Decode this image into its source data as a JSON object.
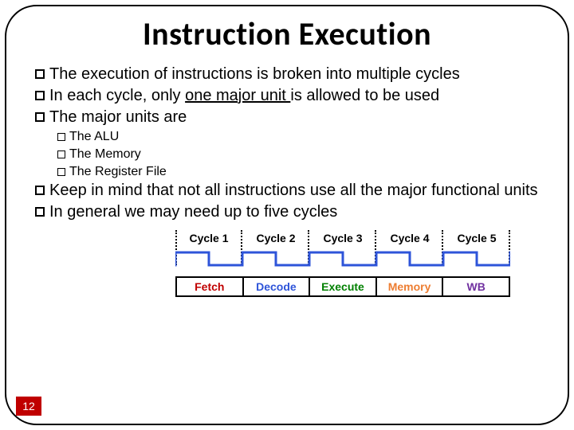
{
  "title": "Instruction Execution",
  "bullets": [
    {
      "level": 1,
      "pre": "The execution of instructions is broken into multiple ",
      "u": "",
      "post": "cycles"
    },
    {
      "level": 1,
      "pre": "In each cycle, only ",
      "u": "one major unit ",
      "post": "is allowed to be used"
    },
    {
      "level": 1,
      "pre": "The major units are",
      "u": "",
      "post": ""
    },
    {
      "level": 2,
      "pre": "The ALU",
      "u": "",
      "post": ""
    },
    {
      "level": 2,
      "pre": "The Memory",
      "u": "",
      "post": ""
    },
    {
      "level": 2,
      "pre": "The Register File",
      "u": "",
      "post": ""
    },
    {
      "level": 1,
      "pre": "Keep in mind that not all instructions use all the major functional units",
      "u": "",
      "post": ""
    },
    {
      "level": 1,
      "pre": "In general we may need up to five cycles",
      "u": "",
      "post": ""
    }
  ],
  "cycles": [
    "Cycle 1",
    "Cycle 2",
    "Cycle 3",
    "Cycle 4",
    "Cycle 5"
  ],
  "stages": [
    {
      "label": "Fetch",
      "color": "c-red"
    },
    {
      "label": "Decode",
      "color": "c-blue"
    },
    {
      "label": "Execute",
      "color": "c-green"
    },
    {
      "label": "Memory",
      "color": "c-orange"
    },
    {
      "label": "WB",
      "color": "c-purple"
    }
  ],
  "slide_number": "12"
}
